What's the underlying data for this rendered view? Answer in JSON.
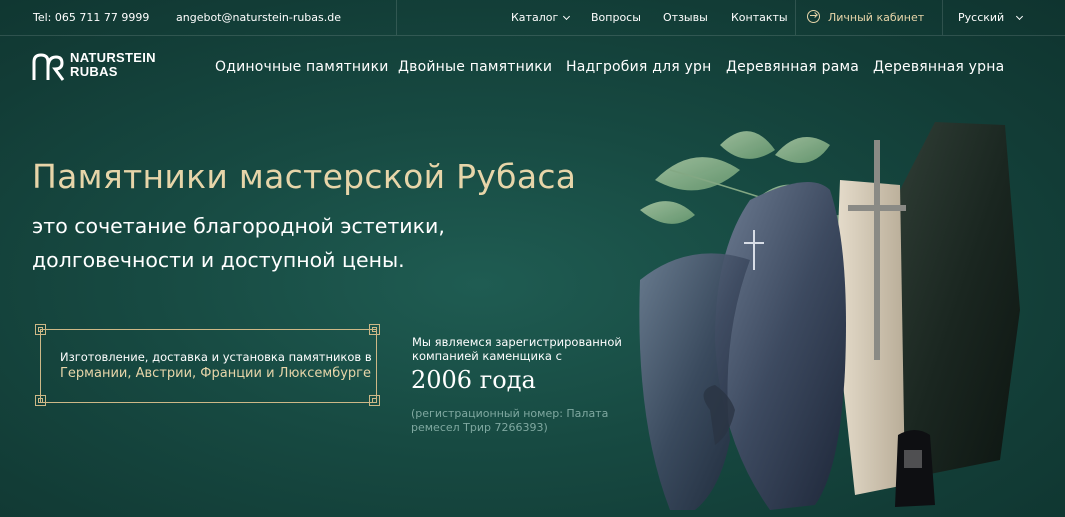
{
  "topbar": {
    "phone": "Tel: 065 711 77 9999",
    "email": "angebot@naturstein-rubas.de",
    "menu": [
      "Каталог",
      "Вопросы",
      "Отзывы",
      "Контакты"
    ],
    "login": "Личный кабинет",
    "language": "Русский"
  },
  "logo": {
    "line1": "NATURSTEIN",
    "line2": "RUBAS"
  },
  "nav": [
    "Одиночные памятники",
    "Двойные памятники",
    "Надгробия для урн",
    "Деревянная рама",
    "Деревянная урна"
  ],
  "hero": {
    "title": "Памятники мастерской Рубаса",
    "subtitle_line1": "это сочетание благородной эстетики,",
    "subtitle_line2": "долговечности и доступной цены.",
    "box_line1": "Изготовление, доставка и установка памятников в",
    "box_line2": "Германии, Австрии, Франции и Люксембурге",
    "reg_line1": "Мы являемся зарегистрированной",
    "reg_line2": "компанией каменщика с",
    "year": "2006 года",
    "regnum_line1": "(регистрационный номер: Палата",
    "regnum_line2": "ремесел Трир 7266393)"
  },
  "colors": {
    "accent": "#e7d5a9",
    "background": "#174a42",
    "muted": "#7fa8a0"
  },
  "icons": {
    "login": "login-arrow-icon",
    "dropdown": "chevron-down-icon",
    "logo": "rubas-monogram-icon"
  }
}
